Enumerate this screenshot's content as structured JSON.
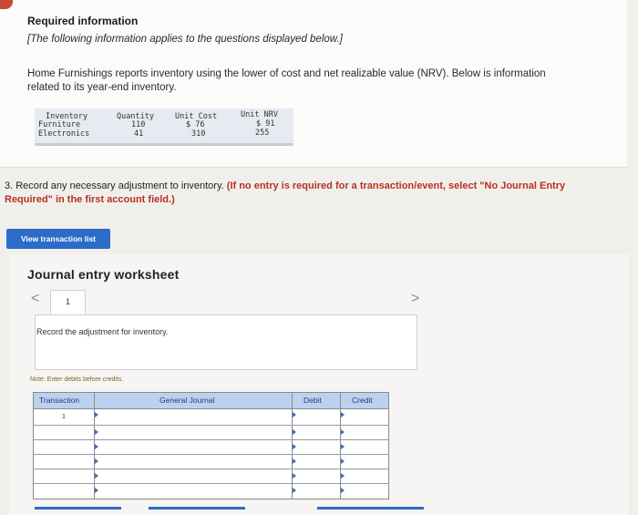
{
  "header": {
    "title": "Required information",
    "note": "[The following information applies to the questions displayed below.]",
    "paragraph": "Home Furnishings reports inventory using the lower of cost and net realizable value (NRV). Below is information related to its year-end inventory."
  },
  "inventory_table": {
    "headers": [
      "Inventory",
      "Quantity",
      "Unit Cost",
      "Unit NRV"
    ],
    "rows": [
      [
        "Furniture",
        "110",
        "$ 76",
        "$ 91"
      ],
      [
        "Electronics",
        "41",
        "310",
        "255"
      ]
    ]
  },
  "question": {
    "text": "3. Record any necessary adjustment to inventory.",
    "instruction": "(If no entry is required for a transaction/event, select \"No Journal Entry Required\" in the first account field.)"
  },
  "buttons": {
    "view_transaction_list": "View transaction list"
  },
  "worksheet": {
    "title": "Journal entry worksheet",
    "prev_glyph": "<",
    "next_glyph": ">",
    "tab_label": "1",
    "instruction": "Record the adjustment for inventory.",
    "note": "Note: Enter debits before credits.",
    "columns": [
      "Transaction",
      "General Journal",
      "Debit",
      "Credit"
    ],
    "first_transaction": "1"
  },
  "colors": {
    "accent": "#2c6cc9",
    "header_fill": "#bcd1ee",
    "highlight": "#b5321f"
  }
}
